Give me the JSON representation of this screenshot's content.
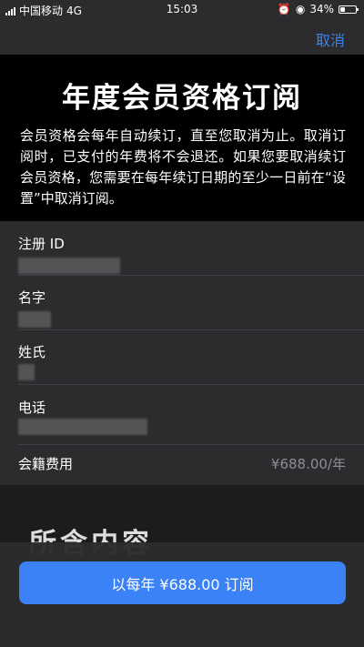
{
  "status_bar": {
    "carrier": "中国移动",
    "network": "4G",
    "time": "15:03",
    "battery_percent": "34%",
    "battery_level": 0.34
  },
  "nav": {
    "cancel_label": "取消"
  },
  "header": {
    "title": "年度会员资格订阅",
    "description": "会员资格会每年自动续订，直至您取消为止。取消订阅时，已支付的年费将不会退还。如果您要取消续订会员资格，您需要在每年续订日期的至少一日前在“设置”中取消订阅。"
  },
  "form": {
    "fields": [
      {
        "label": "注册 ID",
        "value_hidden": true
      },
      {
        "label": "名字",
        "value_hidden": true
      },
      {
        "label": "姓氏",
        "value_hidden": true
      },
      {
        "label": "电话",
        "value_hidden": true
      }
    ],
    "fee": {
      "label": "会籍费用",
      "value": "¥688.00/年"
    }
  },
  "partially_hidden_heading": "所含内容",
  "subscribe_button": {
    "label": "以每年 ¥688.00 订阅"
  },
  "colors": {
    "accent": "#3b82f6",
    "background": "#1c1c1e",
    "card": "#2c2c2e",
    "header": "#000000"
  }
}
